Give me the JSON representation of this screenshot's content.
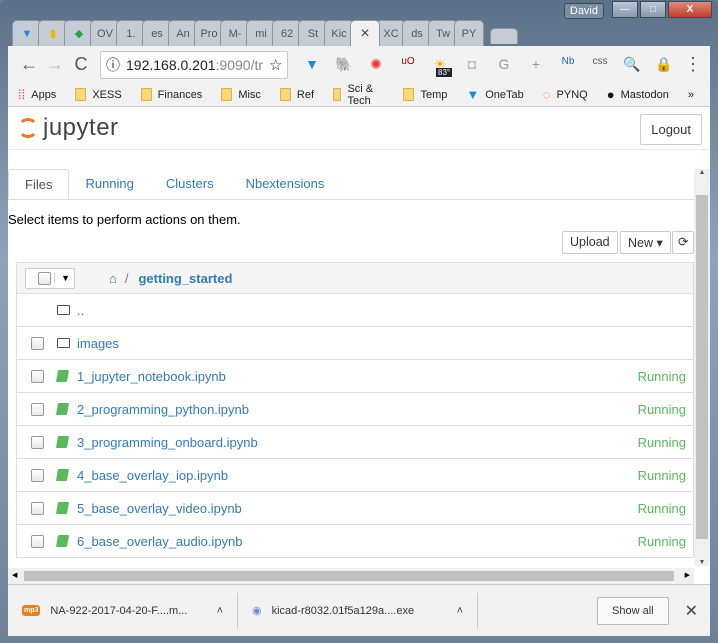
{
  "window": {
    "user": "David",
    "min": "—",
    "max": "□",
    "close": "X"
  },
  "tabs": [
    "",
    "",
    "",
    "OV",
    "1.",
    "es",
    "An",
    "Pro",
    "M-",
    "mi",
    "62",
    "St",
    "Kic",
    "×",
    "XC",
    "ds",
    "Tw",
    "PY"
  ],
  "toolbar": {
    "back": "←",
    "forward": "→",
    "reload": "C",
    "url_host": "192.168.0.201",
    "url_rest": ":9090/tr",
    "info": "ⓘ",
    "star": "☆",
    "weather_badge": "83°",
    "extensions": [
      "onetab",
      "evernote",
      "colorpicker",
      "ublock",
      "weather",
      "camera",
      "grammarly",
      "plus",
      "nb",
      "css",
      "search",
      "vpn"
    ],
    "menu": "⋮"
  },
  "bookmarks": [
    {
      "label": "Apps",
      "icon": "apps-icon"
    },
    {
      "label": "XESS",
      "icon": "folder-icon"
    },
    {
      "label": "Finances",
      "icon": "folder-icon"
    },
    {
      "label": "Misc",
      "icon": "folder-icon"
    },
    {
      "label": "Ref",
      "icon": "folder-icon"
    },
    {
      "label": "Sci & Tech",
      "icon": "folder-icon"
    },
    {
      "label": "Temp",
      "icon": "folder-icon"
    },
    {
      "label": "OneTab",
      "icon": "onetab-icon"
    },
    {
      "label": "PYNQ",
      "icon": "pynq-icon"
    },
    {
      "label": "Mastodon",
      "icon": "mastodon-icon"
    }
  ],
  "bookmarks_more": "»",
  "jupyter": {
    "logo": "jupyter",
    "logout": "Logout",
    "tabs": [
      "Files",
      "Running",
      "Clusters",
      "Nbextensions"
    ],
    "hint": "Select items to perform actions on them.",
    "upload": "Upload",
    "new": "New ▾",
    "refresh": "⟳",
    "breadcrumb_sep": "/",
    "folder": "getting_started",
    "rows": [
      {
        "name": "..",
        "type": "folder",
        "status": ""
      },
      {
        "name": "images",
        "type": "folder",
        "status": ""
      },
      {
        "name": "1_jupyter_notebook.ipynb",
        "type": "notebook",
        "status": "Running"
      },
      {
        "name": "2_programming_python.ipynb",
        "type": "notebook",
        "status": "Running"
      },
      {
        "name": "3_programming_onboard.ipynb",
        "type": "notebook",
        "status": "Running"
      },
      {
        "name": "4_base_overlay_iop.ipynb",
        "type": "notebook",
        "status": "Running"
      },
      {
        "name": "5_base_overlay_video.ipynb",
        "type": "notebook",
        "status": "Running"
      },
      {
        "name": "6_base_overlay_audio.ipynb",
        "type": "notebook",
        "status": "Running"
      }
    ]
  },
  "downloads": [
    {
      "name": "NA-922-2017-04-20-F....m...",
      "icon": "mp3-icon"
    },
    {
      "name": "kicad-r8032.01f5a129a....exe",
      "icon": "installer-icon"
    }
  ],
  "show_all": "Show all",
  "close_downloads": "✕"
}
